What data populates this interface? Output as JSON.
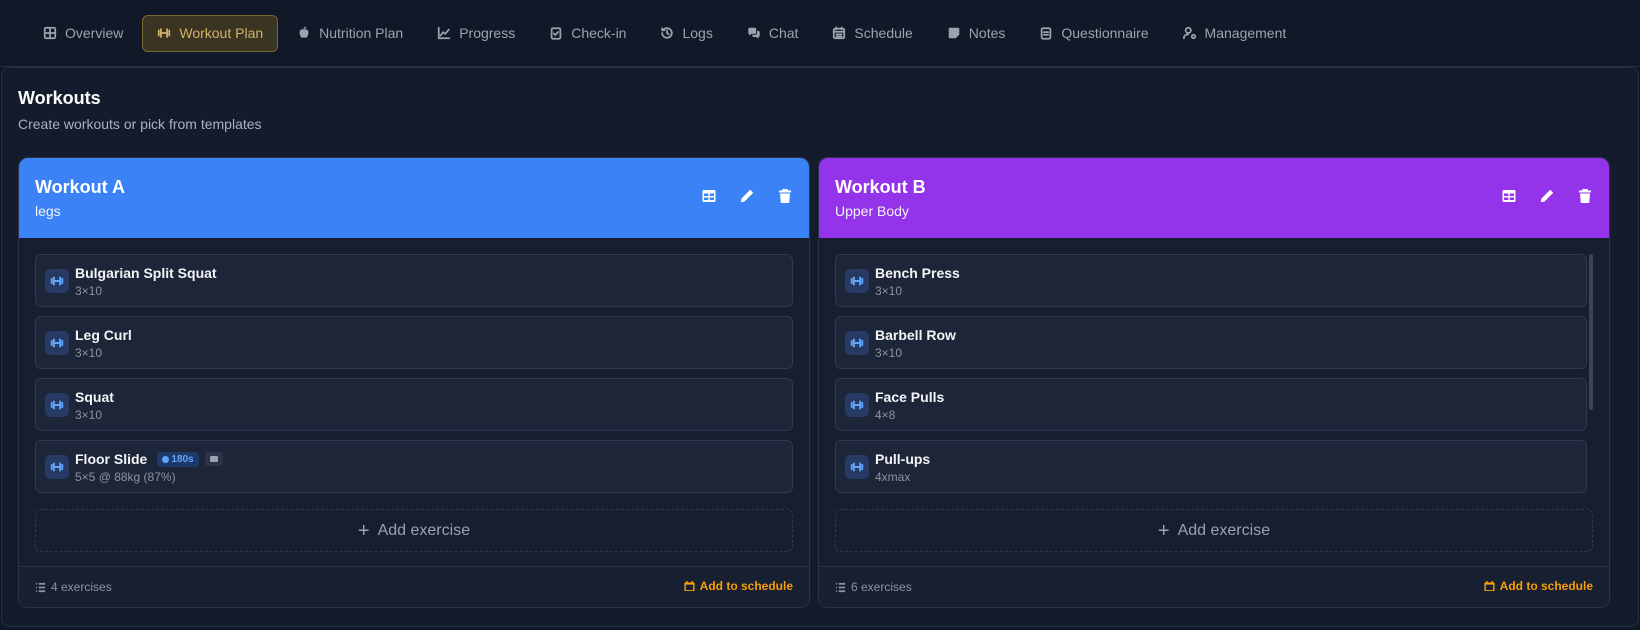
{
  "tabs": [
    {
      "label": "Overview",
      "icon": "grid-icon",
      "active": false
    },
    {
      "label": "Workout Plan",
      "icon": "dumbbell-icon",
      "active": true
    },
    {
      "label": "Nutrition Plan",
      "icon": "apple-icon",
      "active": false
    },
    {
      "label": "Progress",
      "icon": "chart-line-icon",
      "active": false
    },
    {
      "label": "Check-in",
      "icon": "clipboard-check-icon",
      "active": false
    },
    {
      "label": "Logs",
      "icon": "history-icon",
      "active": false
    },
    {
      "label": "Chat",
      "icon": "chat-icon",
      "active": false
    },
    {
      "label": "Schedule",
      "icon": "calendar-icon",
      "active": false
    },
    {
      "label": "Notes",
      "icon": "note-icon",
      "active": false
    },
    {
      "label": "Questionnaire",
      "icon": "clipboard-icon",
      "active": false
    },
    {
      "label": "Management",
      "icon": "user-gear-icon",
      "active": false
    }
  ],
  "page": {
    "title": "Workouts",
    "subtitle": "Create workouts or pick from templates"
  },
  "workouts": [
    {
      "title": "Workout A",
      "subtitle": "legs",
      "color": "#3b82f6",
      "exercises": [
        {
          "name": "Bulgarian Split Squat",
          "detail": "3×10"
        },
        {
          "name": "Leg Curl",
          "detail": "3×10"
        },
        {
          "name": "Squat",
          "detail": "3×10"
        },
        {
          "name": "Floor Slide",
          "detail": "5×5 @ 88kg (87%)",
          "rest": "180s"
        }
      ],
      "add_label": "Add exercise",
      "count_label": "4 exercises",
      "schedule_label": "Add to schedule"
    },
    {
      "title": "Workout B",
      "subtitle": "Upper Body",
      "color": "#9333ea",
      "exercises": [
        {
          "name": "Bench Press",
          "detail": "3×10"
        },
        {
          "name": "Barbell Row",
          "detail": "3×10"
        },
        {
          "name": "Face Pulls",
          "detail": "4×8"
        },
        {
          "name": "Pull-ups",
          "detail": "4xmax"
        }
      ],
      "add_label": "Add exercise",
      "count_label": "6 exercises",
      "schedule_label": "Add to schedule"
    }
  ],
  "colors": {
    "accent_active_tab": "#d4b26a",
    "schedule_accent": "#f59e0b",
    "exercise_icon": "#60a5fa"
  }
}
